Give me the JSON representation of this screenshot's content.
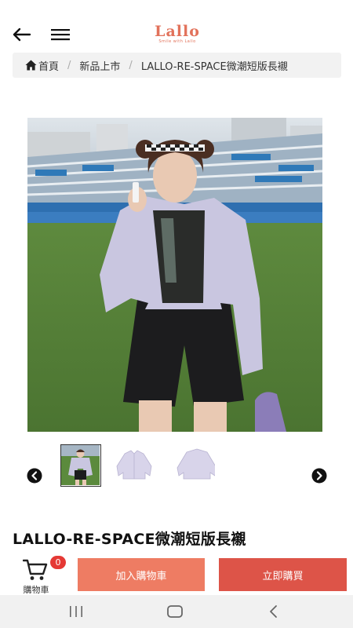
{
  "header": {
    "logo_text": "Lallo",
    "logo_tagline": "Smile with Lallo"
  },
  "breadcrumb": {
    "home": "首頁",
    "category": "新品上市",
    "current": "LALLO-RE-SPACE微潮短版長襯",
    "separator": "/"
  },
  "product": {
    "title": "LALLO-RE-SPACE微潮短版長襯",
    "thumbnail_count": 3,
    "active_thumbnail": 1
  },
  "bottom_bar": {
    "cart_label": "購物車",
    "cart_count": "0",
    "add_to_cart": "加入購物車",
    "buy_now": "立即購買"
  },
  "colors": {
    "brand": "#e2725b",
    "add_to_cart_bg": "#ee7c63",
    "buy_now_bg": "#dd5448",
    "badge": "#e53935"
  }
}
